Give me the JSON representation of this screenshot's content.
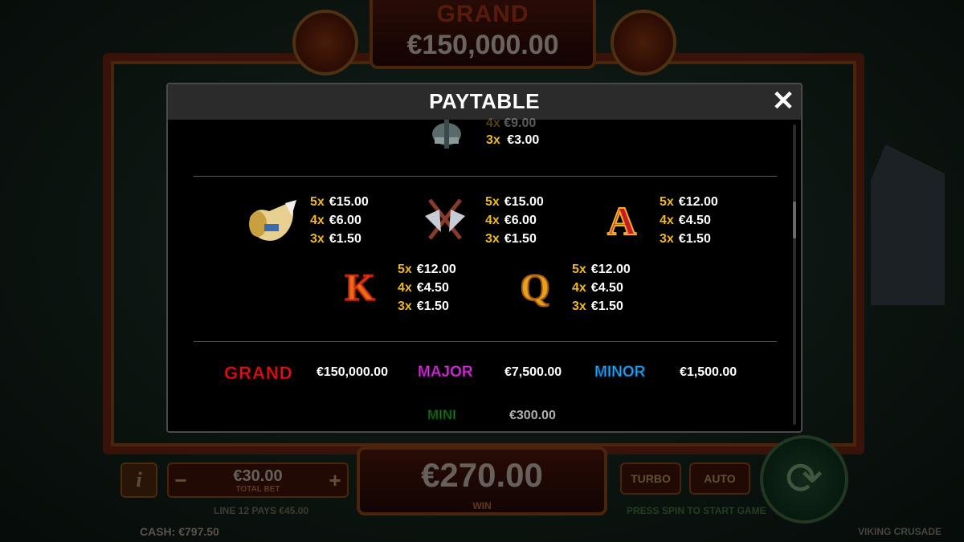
{
  "background": {
    "grand_label": "GRAND",
    "grand_value": "€150,000.00",
    "bet_value": "€30.00",
    "bet_label": "TOTAL BET",
    "bet_minus": "−",
    "bet_plus": "+",
    "info_label": "i",
    "lines_text": "LINE 12 PAYS €45.00",
    "win_value": "€270.00",
    "win_label": "WIN",
    "turbo_label": "TURBO",
    "auto_label": "AUTO",
    "press_text": "PRESS SPIN TO START GAME",
    "cash_text": "CASH: €797.50",
    "game_name": "VIKING CRUSADE"
  },
  "modal": {
    "title": "PAYTABLE",
    "close_glyph": "✕",
    "top_partial": {
      "k1": "4x",
      "v1": "€9.00",
      "k2": "3x",
      "v2": "€3.00"
    },
    "symbols": [
      {
        "name": "horn",
        "pays": [
          {
            "k": "5x",
            "v": "€15.00"
          },
          {
            "k": "4x",
            "v": "€6.00"
          },
          {
            "k": "3x",
            "v": "€1.50"
          }
        ]
      },
      {
        "name": "axes",
        "pays": [
          {
            "k": "5x",
            "v": "€15.00"
          },
          {
            "k": "4x",
            "v": "€6.00"
          },
          {
            "k": "3x",
            "v": "€1.50"
          }
        ]
      },
      {
        "name": "A",
        "letter": "A",
        "pays": [
          {
            "k": "5x",
            "v": "€12.00"
          },
          {
            "k": "4x",
            "v": "€4.50"
          },
          {
            "k": "3x",
            "v": "€1.50"
          }
        ]
      },
      {
        "name": "K",
        "letter": "K",
        "pays": [
          {
            "k": "5x",
            "v": "€12.00"
          },
          {
            "k": "4x",
            "v": "€4.50"
          },
          {
            "k": "3x",
            "v": "€1.50"
          }
        ]
      },
      {
        "name": "Q",
        "letter": "Q",
        "pays": [
          {
            "k": "5x",
            "v": "€12.00"
          },
          {
            "k": "4x",
            "v": "€4.50"
          },
          {
            "k": "3x",
            "v": "€1.50"
          }
        ]
      }
    ],
    "jackpots": [
      {
        "label": "GRAND",
        "value": "€150,000.00",
        "color": "#e0141a"
      },
      {
        "label": "MAJOR",
        "value": "€7,500.00",
        "color": "#d23ad8"
      },
      {
        "label": "MINOR",
        "value": "€1,500.00",
        "color": "#2aa8ea"
      },
      {
        "label": "MINI",
        "value": "€300.00",
        "color": "#2e9a2e"
      }
    ]
  },
  "colors": {
    "multiplier": "#f0b820",
    "value": "#ffffff",
    "header": "#2b2b2b"
  }
}
